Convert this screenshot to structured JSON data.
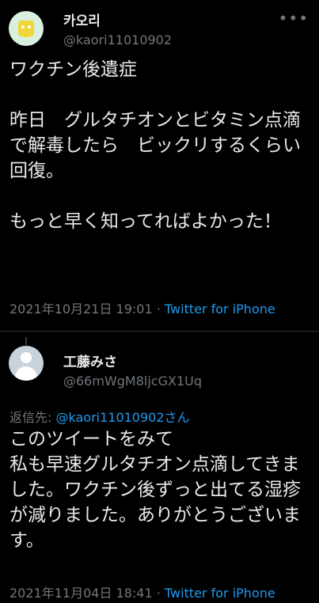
{
  "tweets": [
    {
      "name": "카오리",
      "handle": "@kaori11010902",
      "body": "ワクチン後遺症\n\n昨日　グルタチオンとビタミン点滴で解毒したら　ビックリするくらい回復。\n\nもっと早く知ってればよかった！",
      "timestamp": "2021年10月21日 19:01",
      "separator": " · ",
      "source": "Twitter for iPhone",
      "more_label": "•••"
    },
    {
      "name": "工藤みさ",
      "handle": "@66mWgM8ljcGX1Uq",
      "reply_prefix": "返信先: ",
      "reply_mention": "@kaori11010902さん",
      "body": "このツイートをみて\n私も早速グルタチオン点滴してきました。ワクチン後ずっと出てる湿疹が減りました。ありがとうございます。",
      "timestamp": "2021年11月04日 18:41",
      "separator": " · ",
      "source": "Twitter for iPhone"
    }
  ]
}
